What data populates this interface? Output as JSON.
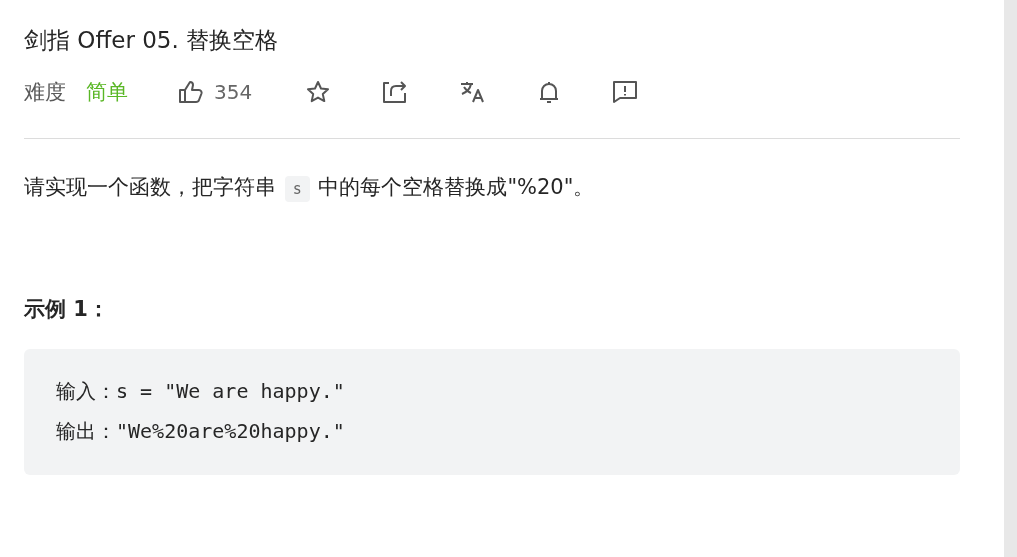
{
  "title": "剑指 Offer 05. 替换空格",
  "meta": {
    "difficulty_label": "难度",
    "difficulty": "简单",
    "likes": "354"
  },
  "description": {
    "before": "请实现一个函数，把字符串 ",
    "code": "s",
    "after": " 中的每个空格替换成\"%20\"。"
  },
  "examples": [
    {
      "heading": "示例 1：",
      "lines": [
        "输入：s = \"We are happy.\"",
        "输出：\"We%20are%20happy.\""
      ]
    }
  ]
}
